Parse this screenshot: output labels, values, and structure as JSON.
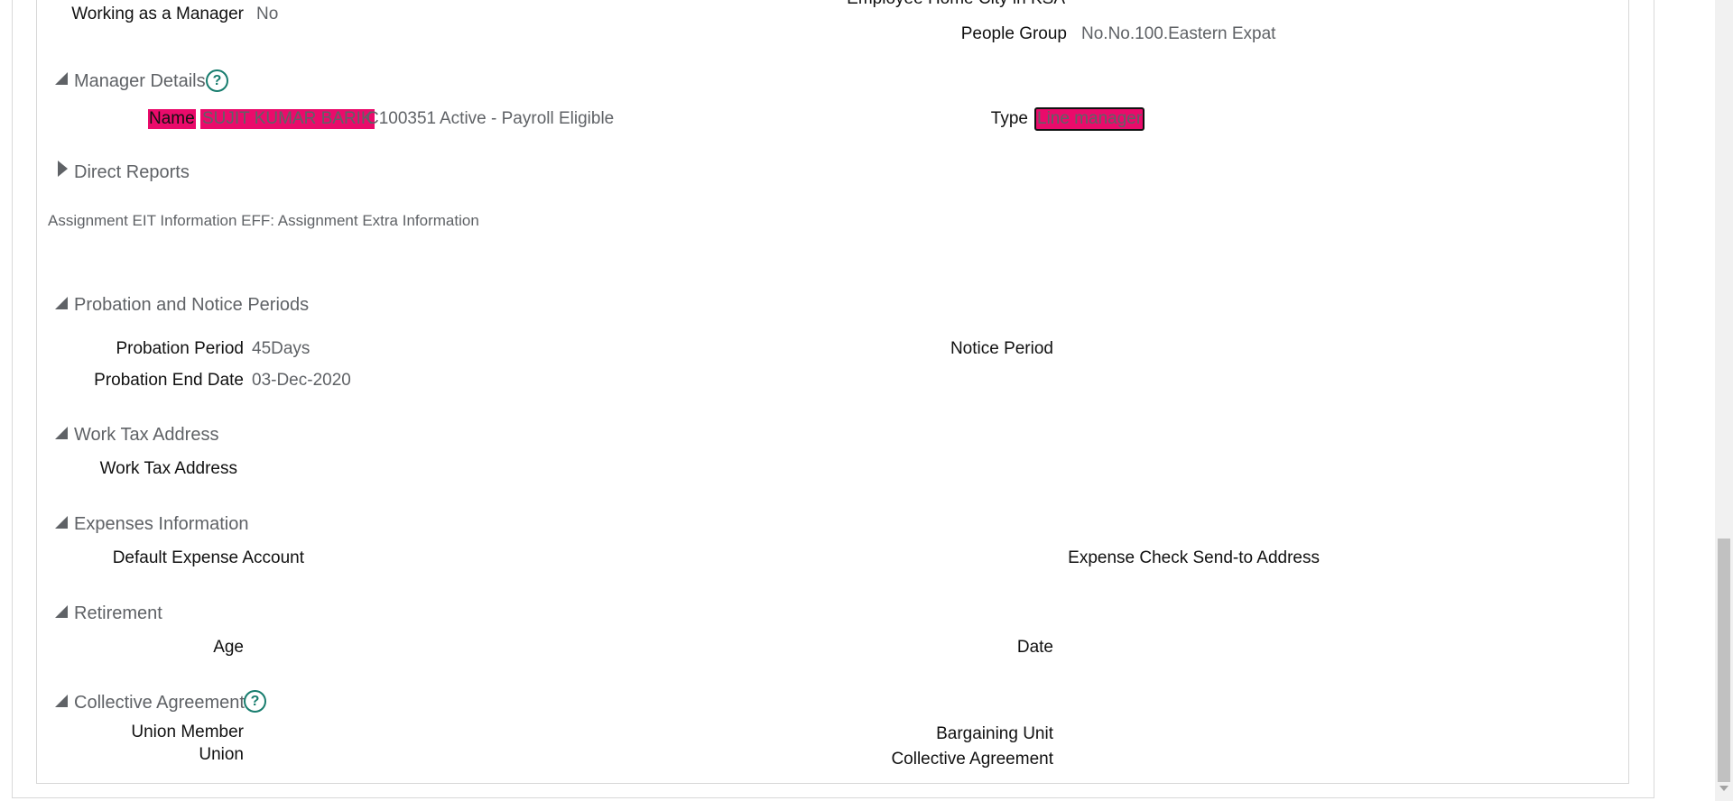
{
  "top": {
    "working_manager_label": "Working as a Manager",
    "working_manager_value": "No",
    "home_city_label": "Employee Home City in KSA",
    "people_group_label": "People Group",
    "people_group_value": "No.No.100.Eastern Expat"
  },
  "manager_details": {
    "title": "Manager Details",
    "name_label": "Name",
    "name_value": "SUJIT KUMAR BARIK",
    "id": "C100351",
    "status": "Active - Payroll Eligible",
    "type_label": "Type",
    "type_value": "Line manager"
  },
  "direct_reports": {
    "title": "Direct Reports"
  },
  "eit": {
    "title": "Assignment EIT Information EFF: Assignment Extra Information"
  },
  "probation": {
    "title": "Probation and Notice Periods",
    "period_label": "Probation Period",
    "period_value": "45Days",
    "end_date_label": "Probation End Date",
    "end_date_value": "03-Dec-2020",
    "notice_label": "Notice Period"
  },
  "work_tax": {
    "title": "Work Tax Address",
    "address_label": "Work Tax Address"
  },
  "expenses": {
    "title": "Expenses Information",
    "default_account_label": "Default Expense Account",
    "check_address_label": "Expense Check Send-to Address"
  },
  "retirement": {
    "title": "Retirement",
    "age_label": "Age",
    "date_label": "Date"
  },
  "collective": {
    "title": "Collective Agreement",
    "union_member_label": "Union Member",
    "union_label": "Union",
    "bargaining_label": "Bargaining Unit",
    "agreement_label": "Collective Agreement"
  },
  "icons": {
    "help": "question-circle-icon",
    "expand": "triangle-down-icon",
    "collapse": "triangle-right-icon"
  },
  "colors": {
    "highlight": "#ea0b6b",
    "help": "#187d6e",
    "muted": "#5f6266"
  }
}
